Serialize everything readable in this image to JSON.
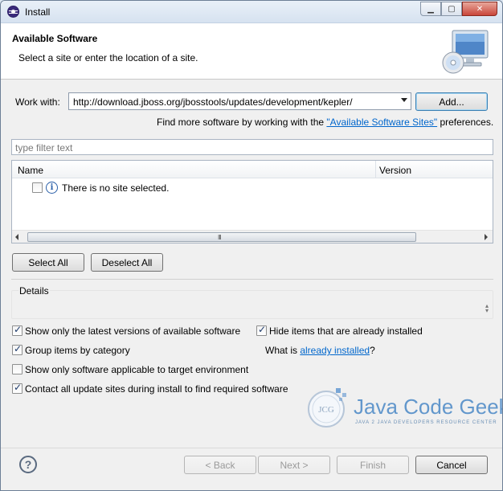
{
  "window": {
    "title": "Install"
  },
  "header": {
    "title": "Available Software",
    "description": "Select a site or enter the location of a site."
  },
  "work_with": {
    "label": "Work with:",
    "value": "http://download.jboss.org/jbosstools/updates/development/kepler/",
    "add_button": "Add...",
    "more_prefix": "Find more software by working with the ",
    "more_link": "\"Available Software Sites\"",
    "more_suffix": " preferences."
  },
  "filter": {
    "placeholder": "type filter text"
  },
  "table": {
    "columns": [
      "Name",
      "Version"
    ],
    "rows": [
      {
        "checked": false,
        "icon": "info-icon",
        "text": "There is no site selected."
      }
    ]
  },
  "selection": {
    "select_all": "Select All",
    "deselect_all": "Deselect All"
  },
  "details": {
    "title": "Details"
  },
  "options": {
    "latest_versions": {
      "label": "Show only the latest versions of available software",
      "checked": true
    },
    "hide_installed": {
      "label": "Hide items that are already installed",
      "checked": true
    },
    "group_by_category": {
      "label": "Group items by category",
      "checked": true
    },
    "what_is_prefix": "What is ",
    "what_is_link": "already installed",
    "what_is_suffix": "?",
    "target_env": {
      "label": "Show only software applicable to target environment",
      "checked": false
    },
    "contact_sites": {
      "label": "Contact all update sites during install to find required software",
      "checked": true
    }
  },
  "watermark": {
    "text": "Java Code Geeks",
    "subtitle": "JAVA 2 JAVA DEVELOPERS RESOURCE CENTER",
    "badge": "JCG"
  },
  "footer": {
    "back": "< Back",
    "next": "Next >",
    "finish": "Finish",
    "cancel": "Cancel"
  },
  "colors": {
    "link": "#0066cc",
    "title_bar": "#d6e2f0",
    "logo": "#4a88c6"
  }
}
